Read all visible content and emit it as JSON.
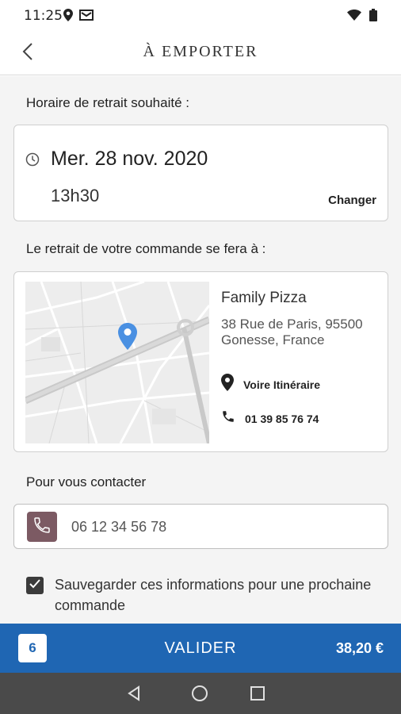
{
  "status_bar": {
    "time": "11:25",
    "left_icons": [
      "location-icon",
      "mail-icon"
    ],
    "right_icons": [
      "wifi-icon",
      "battery-icon"
    ]
  },
  "app_bar": {
    "title": "À EMPORTER",
    "back_icon": "chevron-left-icon"
  },
  "pickup": {
    "label": "Horaire de retrait souhaité :",
    "date": "Mer. 28 nov. 2020",
    "time": "13h30",
    "change_label": "Changer"
  },
  "location": {
    "label": "Le retrait de votre commande se fera à :",
    "shop_name": "Family Pizza",
    "address": "38 Rue de Paris, 95500 Gonesse, France",
    "itinerary_label": "Voire Itinéraire",
    "phone": "01 39 85 76 74"
  },
  "contact": {
    "label": "Pour vous contacter",
    "phone_value": "06 12 34 56 78"
  },
  "save": {
    "checked": true,
    "label": "Sauvegarder ces informations pour une prochaine commande"
  },
  "validate": {
    "count": "6",
    "label": "VALIDER",
    "total": "38,20 €"
  },
  "colors": {
    "accent": "#1f66b3",
    "phone_badge": "#7c5a63",
    "map_pin": "#4a90e2"
  }
}
